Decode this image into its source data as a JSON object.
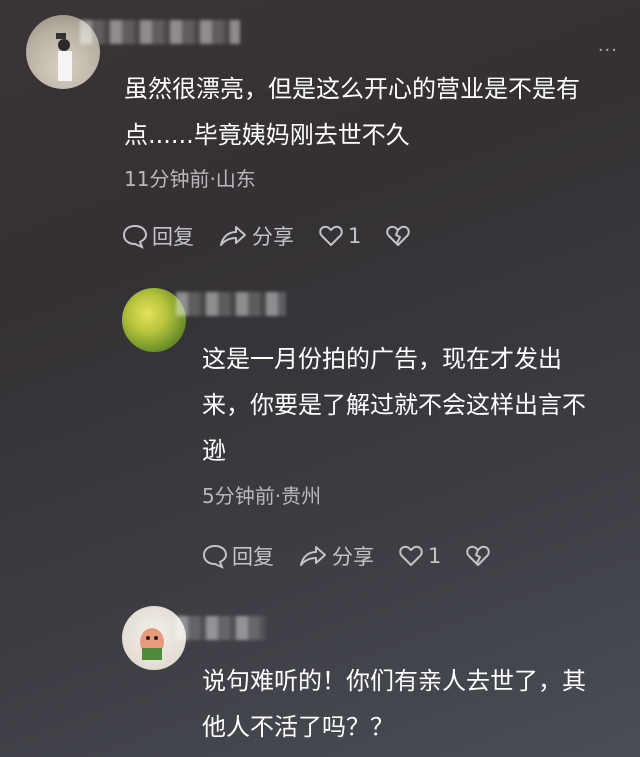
{
  "comments": [
    {
      "text_line1": "虽然很漂亮，但是这么开心的营业是不是有",
      "text_line2": "点......毕竟姨妈刚去世不久",
      "meta": "11分钟前·山东",
      "reply_label": "回复",
      "share_label": "分享",
      "like_count": "1",
      "avatar_icon": "avatar-person-photo",
      "more_icon": "more-dots-icon"
    },
    {
      "text_line1": "这是一月份拍的广告，现在才发出",
      "text_line2": "来，你要是了解过就不会这样出言不",
      "text_line3": "逊",
      "meta": "5分钟前·贵州",
      "reply_label": "回复",
      "share_label": "分享",
      "like_count": "1",
      "avatar_icon": "avatar-green-photo"
    },
    {
      "text_line1": "说句难听的！你们有亲人去世了，其",
      "text_line2": "他人不活了吗？？",
      "avatar_icon": "avatar-cartoon"
    }
  ],
  "colors": {
    "text": "#ffffff",
    "meta": "#b9b9bd",
    "action": "#c4c4c8"
  }
}
